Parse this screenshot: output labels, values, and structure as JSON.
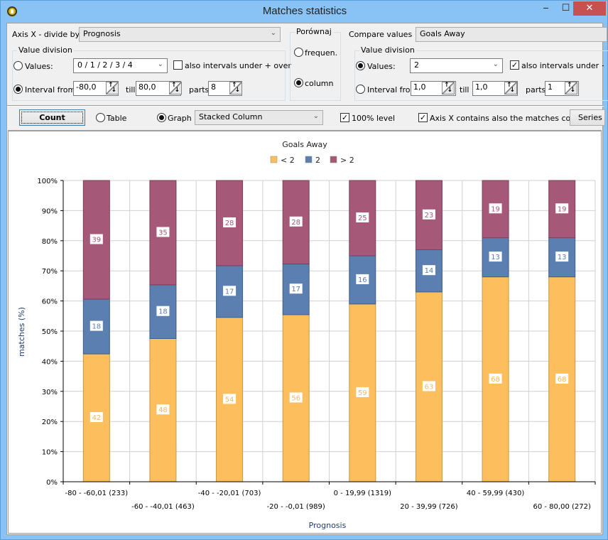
{
  "window": {
    "title": "Matches statistics",
    "icon": "app-coin-icon",
    "controls": {
      "minimize": "‒",
      "maximize": "☐",
      "close": "✕"
    }
  },
  "axis_x": {
    "label": "Axis X - divide by",
    "selected": "Prognosis",
    "value_division": {
      "title": "Value division",
      "values_label": "Values:",
      "values_selected": false,
      "values_value": "0 / 1 / 2 / 3 / 4",
      "also_intervals_label": "also intervals under + over",
      "also_intervals_checked": false,
      "interval_label": "Interval from",
      "interval_selected": true,
      "from": "-80,0",
      "till_label": "till",
      "till": "80,0",
      "parts_label": "parts",
      "parts": "8"
    }
  },
  "porownaj": {
    "title": "Porównaj",
    "frequen_label": "frequen.",
    "frequen_selected": false,
    "column_label": "column",
    "column_selected": true
  },
  "compare": {
    "label": "Compare values",
    "selected": "Goals Away",
    "value_division": {
      "title": "Value division",
      "values_label": "Values:",
      "values_selected": true,
      "values_value": "2",
      "also_intervals_label": "also intervals under + over",
      "also_intervals_checked": true,
      "interval_label": "Interval from",
      "interval_selected": false,
      "from": "1,0",
      "till_label": "till",
      "till": "1,0",
      "parts_label": "parts",
      "parts": "1"
    }
  },
  "toolbar": {
    "count_label": "Count",
    "table_label": "Table",
    "table_selected": false,
    "graph_label": "Graph",
    "graph_selected": true,
    "graph_type": "Stacked Column",
    "level100_label": "100% level",
    "level100_checked": true,
    "axis_count_label": "Axis X contains also the matches count",
    "axis_count_checked": true,
    "series_label": "Series ..."
  },
  "chart_data": {
    "type": "bar",
    "stacked": true,
    "percent": true,
    "title": "Goals Away",
    "xlabel": "Prognosis",
    "ylabel": "matches (%)",
    "ylim": [
      0,
      100
    ],
    "yticks": [
      "0%",
      "10%",
      "20%",
      "30%",
      "40%",
      "50%",
      "60%",
      "70%",
      "80%",
      "90%",
      "100%"
    ],
    "grid": true,
    "legend_position": "top-center",
    "categories": [
      "-80 - -60,01 (233)",
      "-60 - -40,01 (463)",
      "-40 - -20,01 (703)",
      "-20 - -0,01 (989)",
      "0 - 19,99 (1319)",
      "20 - 39,99 (726)",
      "40 - 59,99 (430)",
      "60 - 80,00 (272)"
    ],
    "series": [
      {
        "name": "< 2",
        "color": "#fdbf5e",
        "label_color": "#f4b860",
        "values": [
          42,
          48,
          54,
          56,
          59,
          63,
          68,
          68
        ]
      },
      {
        "name": "2",
        "color": "#5b7fb0",
        "label_color": "#5b7fb0",
        "values": [
          18,
          18,
          17,
          17,
          16,
          14,
          13,
          13
        ]
      },
      {
        "name": "> 2",
        "color": "#a55878",
        "label_color": "#a55878",
        "values": [
          39,
          35,
          28,
          28,
          25,
          23,
          19,
          19
        ]
      }
    ]
  }
}
